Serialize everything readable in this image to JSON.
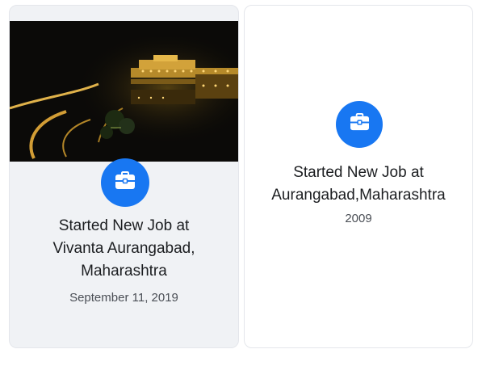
{
  "life_events": [
    {
      "title_line1": "Started New Job at",
      "title_line2": "Vivanta Aurangabad,",
      "title_line3": "Maharashtra",
      "date": "September 11, 2019",
      "icon": "briefcase-icon",
      "has_photo": true
    },
    {
      "title_line1": "Started New Job at",
      "title_line2": "Aurangabad,Maharashtra",
      "date": "2009",
      "icon": "briefcase-icon",
      "has_photo": false
    }
  ],
  "colors": {
    "accent": "#1877f2",
    "card_bg_left": "#f0f2f5",
    "card_bg_right": "#ffffff",
    "title_text": "#1c1e21",
    "date_text": "#4b4f56"
  }
}
